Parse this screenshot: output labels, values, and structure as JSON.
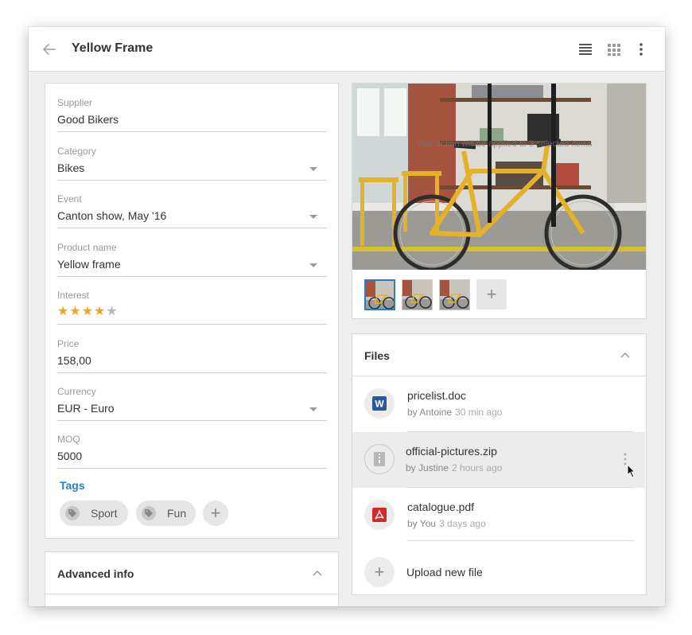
{
  "header": {
    "title": "Yellow Frame",
    "back_icon": "arrow-left-icon",
    "icons": [
      "list-view-icon",
      "grid-view-icon",
      "more-vert-icon"
    ]
  },
  "details": {
    "fields": [
      {
        "label": "Supplier",
        "value": "Good Bikers",
        "dropdown": false
      },
      {
        "label": "Category",
        "value": "Bikes",
        "dropdown": true
      },
      {
        "label": "Event",
        "value": "Canton show, May '16",
        "dropdown": true
      },
      {
        "label": "Product name",
        "value": "Yellow frame",
        "dropdown": true
      },
      {
        "label": "Interest",
        "rating": 4,
        "rating_max": 5
      },
      {
        "label": "Price",
        "value": "158,00",
        "dropdown": false
      },
      {
        "label": "Currency",
        "value": "EUR - Euro",
        "dropdown": true
      },
      {
        "label": "MOQ",
        "value": "5000",
        "dropdown": false
      }
    ],
    "interest_stars": "★★★★",
    "interest_star_empty": "★",
    "tags_title": "Tags",
    "tags": [
      "Sport",
      "Fun"
    ],
    "add_tag_label": "+"
  },
  "advanced": {
    "title": "Advanced info"
  },
  "gallery": {
    "caption": "Your action will be applied to 3 selected items",
    "thumbnail_count": 3,
    "selected_index": 0,
    "add_label": "+"
  },
  "files": {
    "title": "Files",
    "items": [
      {
        "name": "pricelist.doc",
        "by": "by Antoine",
        "when": "30 min ago",
        "icon": "word-doc-icon"
      },
      {
        "name": "official-pictures.zip",
        "by": "by Justine",
        "when": "2 hours ago",
        "icon": "zip-file-icon",
        "highlighted": true
      },
      {
        "name": "catalogue.pdf",
        "by": "by You",
        "when": "3 days ago",
        "icon": "pdf-file-icon"
      }
    ],
    "upload_label": "Upload new file",
    "upload_plus": "+"
  },
  "colors": {
    "accent": "#2a7fc4",
    "star": "#f2a51a",
    "word": "#2b579a",
    "pdf": "#d22a2a"
  }
}
